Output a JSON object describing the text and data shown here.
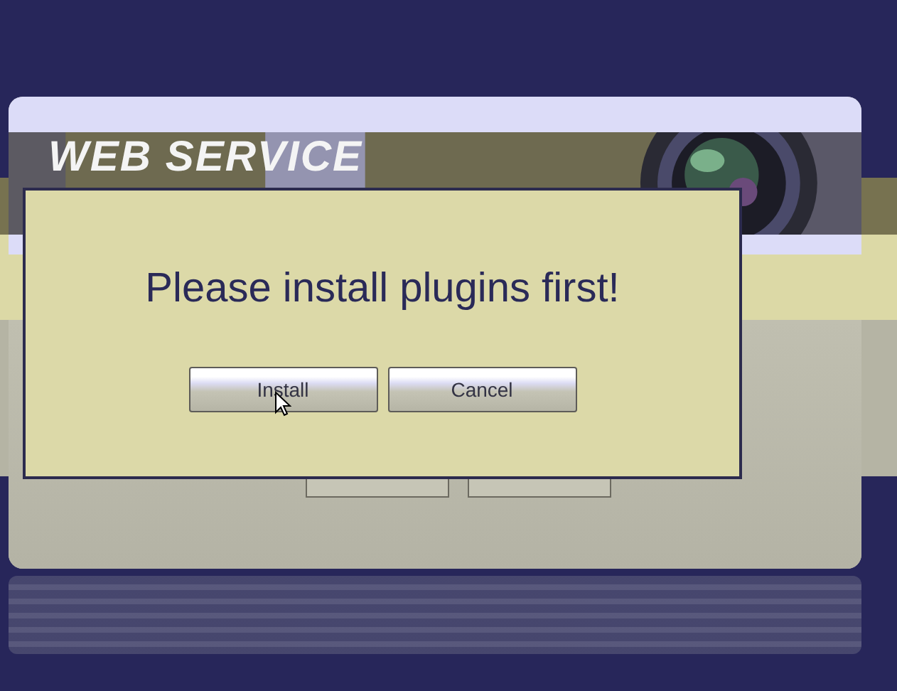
{
  "banner": {
    "title": "WEB SERVICE"
  },
  "dialog": {
    "message": "Please install plugins first!",
    "buttons": [
      {
        "label": "Install"
      },
      {
        "label": "Cancel"
      }
    ]
  }
}
